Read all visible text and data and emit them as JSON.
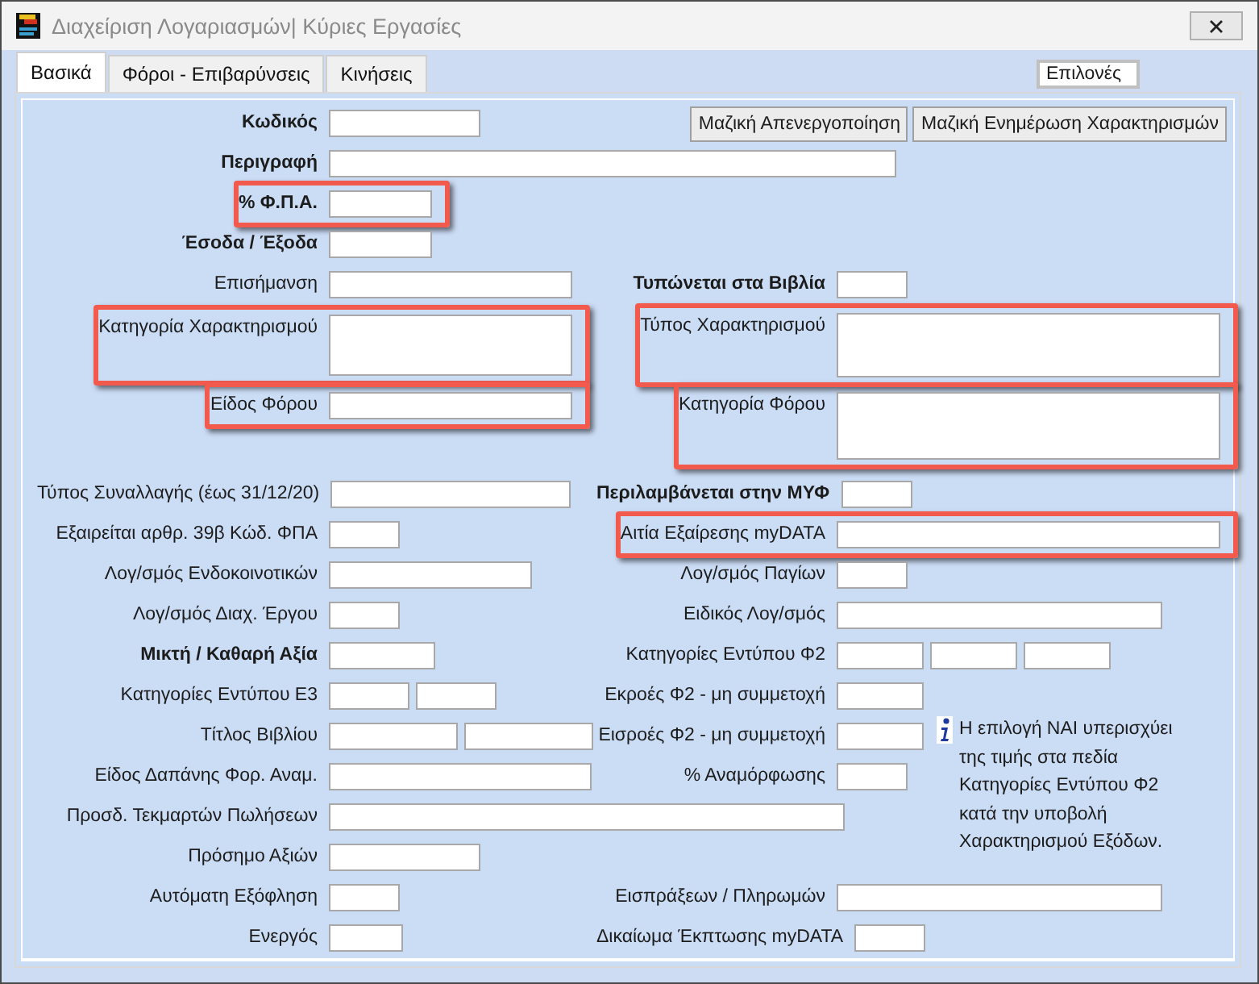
{
  "window": {
    "title": "Διαχείριση Λογαριασμών| Κύριες Εργασίες"
  },
  "tabs": [
    {
      "label": "Βασικά",
      "selected": true
    },
    {
      "label": "Φόροι - Επιβαρύνσεις",
      "selected": false
    },
    {
      "label": "Κινήσεις",
      "selected": false
    }
  ],
  "options_field": {
    "value": "Επιλονές"
  },
  "buttons": [
    "Μαζική Απενεργοποίηση",
    "Μαζική Ενημέρωση Χαρακτηρισμών"
  ],
  "left_fields": [
    {
      "label": "Κωδικός",
      "bold": true,
      "highlighted": false
    },
    {
      "label": "Περιγραφή",
      "bold": true,
      "highlighted": false
    },
    {
      "label": "% Φ.Π.Α.",
      "bold": true,
      "highlighted": true
    },
    {
      "label": "Έσοδα / Έξοδα",
      "bold": true,
      "highlighted": false
    },
    {
      "label": "Επισήμανση",
      "bold": false,
      "highlighted": false
    },
    {
      "label": "Κατηγορία Χαρακτηρισμού",
      "bold": false,
      "highlighted": true
    },
    {
      "label": "Είδος Φόρου",
      "bold": false,
      "highlighted": true
    },
    {
      "label": "Τύπος Συναλλαγής (έως 31/12/20)",
      "bold": false,
      "highlighted": false
    },
    {
      "label": "Εξαιρείται αρθρ. 39β Κώδ. ΦΠΑ",
      "bold": false,
      "highlighted": false
    },
    {
      "label": "Λογ/σμός Ενδοκοινοτικών",
      "bold": false,
      "highlighted": false
    },
    {
      "label": "Λογ/σμός Διαχ. Έργου",
      "bold": false,
      "highlighted": false
    },
    {
      "label": "Μικτή  / Καθαρή Αξία",
      "bold": true,
      "highlighted": false
    },
    {
      "label": "Κατηγορίες Εντύπου Ε3",
      "bold": false,
      "highlighted": false
    },
    {
      "label": "Τίτλος Βιβλίου",
      "bold": false,
      "highlighted": false
    },
    {
      "label": "Είδος Δαπάνης Φορ. Αναμ.",
      "bold": false,
      "highlighted": false
    },
    {
      "label": "Προσδ. Τεκμαρτών Πωλήσεων",
      "bold": false,
      "highlighted": false
    },
    {
      "label": "Πρόσημο Αξιών",
      "bold": false,
      "highlighted": false
    },
    {
      "label": "Αυτόματη Εξόφληση",
      "bold": false,
      "highlighted": false
    },
    {
      "label": "Ενεργός",
      "bold": false,
      "highlighted": false
    }
  ],
  "right_fields": [
    {
      "label": "Τυπώνεται στα Βιβλία",
      "bold": true,
      "highlighted": false
    },
    {
      "label": "Τύπος Χαρακτηρισμού",
      "bold": false,
      "highlighted": true
    },
    {
      "label": "Κατηγορία Φόρου",
      "bold": false,
      "highlighted": true
    },
    {
      "label": "Περιλαμβάνεται στην ΜΥΦ",
      "bold": true,
      "highlighted": false
    },
    {
      "label": "Αιτία Εξαίρεσης myDATA",
      "bold": false,
      "highlighted": true
    },
    {
      "label": "Λογ/σμός  Παγίων",
      "bold": false,
      "highlighted": false
    },
    {
      "label": "Ειδικός Λογ/σμός",
      "bold": false,
      "highlighted": false
    },
    {
      "label": "Κατηγορίες Εντύπου Φ2",
      "bold": false,
      "highlighted": false
    },
    {
      "label": "Εκροές Φ2 - μη συμμετοχή",
      "bold": false,
      "highlighted": false
    },
    {
      "label": "Εισροές Φ2 - μη συμμετοχή",
      "bold": false,
      "highlighted": false
    },
    {
      "label": "% Αναμόρφωσης",
      "bold": false,
      "highlighted": false
    },
    {
      "label": "Εισπράξεων / Πληρωμών",
      "bold": false,
      "highlighted": false
    },
    {
      "label": "Δικαίωμα Έκπτωσης myDATA",
      "bold": false,
      "highlighted": false
    }
  ],
  "info_note": "Η επιλογή ΝΑΙ υπερισχύει της τιμής στα πεδία Κατηγορίες Εντύπου Φ2 κατά την υποβολή Χαρακτηρισμού Εξόδων."
}
